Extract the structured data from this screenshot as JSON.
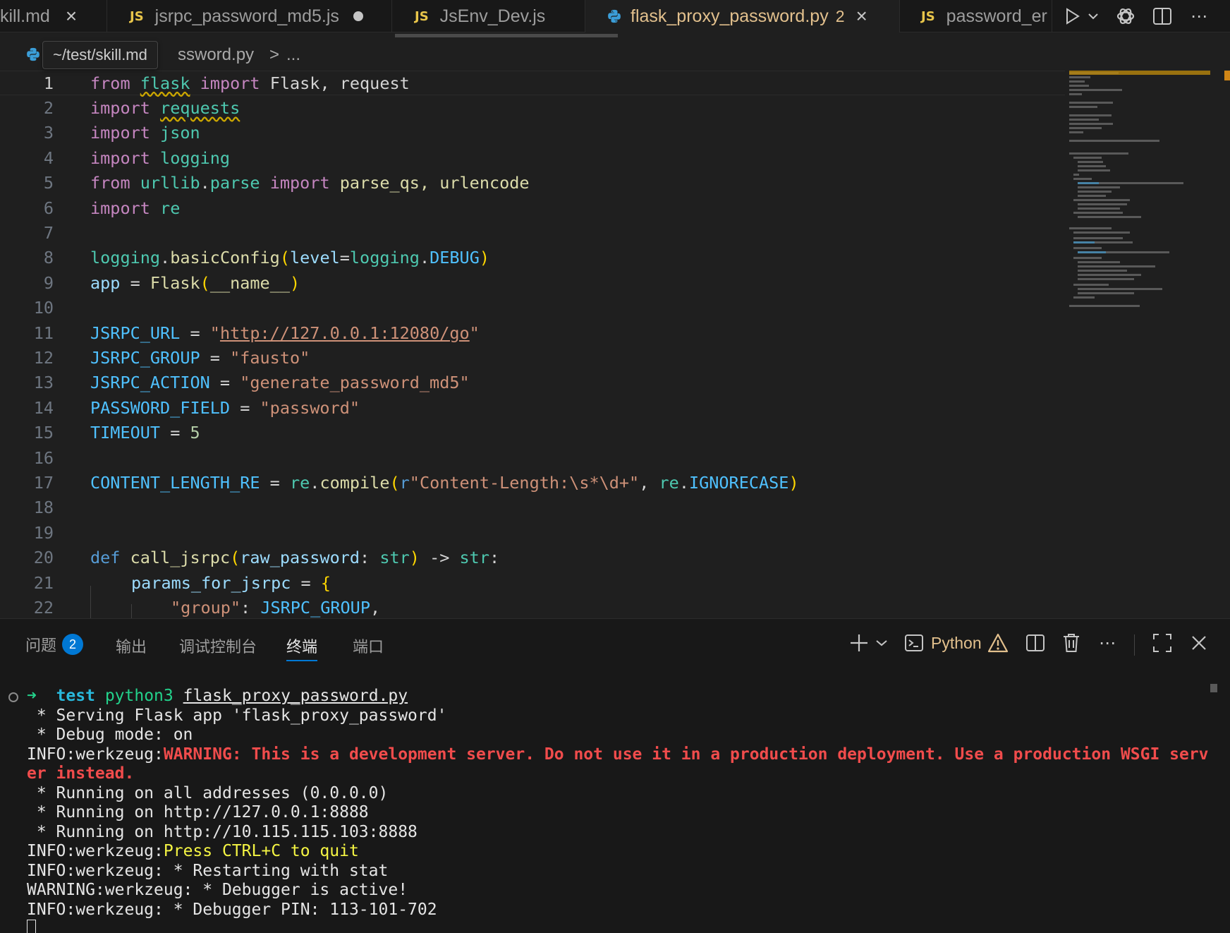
{
  "tabs": [
    {
      "label": "kill.md",
      "type": "md",
      "state": "close"
    },
    {
      "label": "jsrpc_password_md5.js",
      "type": "js",
      "state": "dirty"
    },
    {
      "label": "JsEnv_Dev.js",
      "type": "js",
      "state": "none"
    },
    {
      "label": "flask_proxy_password.py",
      "type": "py",
      "state": "close",
      "active": true,
      "problems": "2"
    },
    {
      "label": "password_er",
      "type": "js",
      "state": "none"
    }
  ],
  "js_badge": "JS",
  "breadcrumb": {
    "file": "ssword.py",
    "sep": ">",
    "more": "..."
  },
  "tooltip": "~/test/skill.md",
  "editor": {
    "lines": [
      "1",
      "2",
      "3",
      "4",
      "5",
      "6",
      "7",
      "8",
      "9",
      "10",
      "11",
      "12",
      "13",
      "14",
      "15",
      "16",
      "17",
      "18",
      "19",
      "20",
      "21",
      "22"
    ],
    "code": {
      "l1": [
        "from",
        "flask",
        "import",
        "Flask, request"
      ],
      "l2": [
        "import",
        "requests"
      ],
      "l3": [
        "import",
        "json"
      ],
      "l4": [
        "import",
        "logging"
      ],
      "l5": [
        "from",
        "urllib",
        ".",
        "parse",
        "import",
        "parse_qs, urlencode"
      ],
      "l6": [
        "import",
        "re"
      ],
      "l8": [
        "logging",
        ".",
        "basicConfig",
        "(",
        "level",
        "=",
        "logging",
        ".",
        "DEBUG",
        ")"
      ],
      "l9": [
        "app",
        " = ",
        "Flask",
        "(",
        "__name__",
        ")"
      ],
      "l11": [
        "JSRPC_URL",
        " = ",
        "\"",
        "http://127.0.0.1:12080/go",
        "\""
      ],
      "l12": [
        "JSRPC_GROUP",
        " = ",
        "\"fausto\""
      ],
      "l13": [
        "JSRPC_ACTION",
        " = ",
        "\"generate_password_md5\""
      ],
      "l14": [
        "PASSWORD_FIELD",
        " = ",
        "\"password\""
      ],
      "l15": [
        "TIMEOUT",
        " = ",
        "5"
      ],
      "l17": [
        "CONTENT_LENGTH_RE",
        " = ",
        "re",
        ".",
        "compile",
        "(",
        "r",
        "\"Content-Length:\\s*\\d+\"",
        ", ",
        "re",
        ".",
        "IGNORECASE",
        ")"
      ],
      "l20": [
        "def",
        "call_jsrpc",
        "(",
        "raw_password",
        ": ",
        "str",
        ")",
        " -> ",
        "str",
        ":"
      ],
      "l21": [
        "params_for_jsrpc",
        " = ",
        "{"
      ],
      "l22": [
        "\"group\"",
        ": ",
        "JSRPC_GROUP",
        ","
      ]
    }
  },
  "panel": {
    "tabs": [
      {
        "label": "问题",
        "badge": "2"
      },
      {
        "label": "输出"
      },
      {
        "label": "调试控制台"
      },
      {
        "label": "终端",
        "active": true
      },
      {
        "label": "端口"
      }
    ],
    "terminal_name": "Python"
  },
  "terminal": {
    "prompt_arrow": "➜",
    "prompt_dir": "test",
    "prompt_cmd": "python3",
    "prompt_arg": "flask_proxy_password.py",
    "line2": " * Serving Flask app 'flask_proxy_password'",
    "line3": " * Debug mode: on",
    "line4_prefix": "INFO:werkzeug:",
    "line4_warning": "WARNING: This is a development server. Do not use it in a production deployment. Use a production WSGI serv",
    "line5_warning": "er instead.",
    "line6": " * Running on all addresses (0.0.0.0)",
    "line7": " * Running on http://127.0.0.1:8888",
    "line8": " * Running on http://10.115.115.103:8888",
    "line9_prefix": "INFO:werkzeug:",
    "line9_msg": "Press CTRL+C to quit",
    "line10": "INFO:werkzeug: * Restarting with stat",
    "line11": "WARNING:werkzeug: * Debugger is active!",
    "line12": "INFO:werkzeug: * Debugger PIN: 113-101-702"
  },
  "colors": {
    "accent": "#0078d4",
    "modified_tab": "#e2c08d",
    "warning_red": "#f14c4c",
    "js_yellow": "#e8c54a"
  }
}
